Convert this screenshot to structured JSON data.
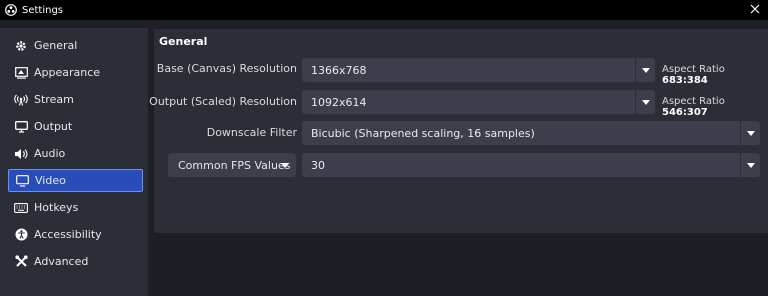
{
  "window": {
    "title": "Settings",
    "app_icon": "obs-logo-icon",
    "close_icon": "close-icon"
  },
  "sidebar": {
    "items": [
      {
        "label": "General",
        "icon": "gear-icon",
        "active": false
      },
      {
        "label": "Appearance",
        "icon": "appearance-icon",
        "active": false
      },
      {
        "label": "Stream",
        "icon": "broadcast-icon",
        "active": false
      },
      {
        "label": "Output",
        "icon": "output-icon",
        "active": false
      },
      {
        "label": "Audio",
        "icon": "speaker-icon",
        "active": false
      },
      {
        "label": "Video",
        "icon": "monitor-icon",
        "active": true
      },
      {
        "label": "Hotkeys",
        "icon": "keyboard-icon",
        "active": false
      },
      {
        "label": "Accessibility",
        "icon": "accessibility-icon",
        "active": false
      },
      {
        "label": "Advanced",
        "icon": "tools-icon",
        "active": false
      }
    ]
  },
  "panel": {
    "title": "General",
    "base_resolution": {
      "label": "Base (Canvas) Resolution",
      "value": "1366x768",
      "aspect_label": "Aspect Ratio",
      "aspect_value": "683:384"
    },
    "output_resolution": {
      "label": "Output (Scaled) Resolution",
      "value": "1092x614",
      "aspect_label": "Aspect Ratio",
      "aspect_value": "546:307"
    },
    "downscale_filter": {
      "label": "Downscale Filter",
      "value": "Bicubic (Sharpened scaling, 16 samples)"
    },
    "fps": {
      "type_label": "Common FPS Values",
      "value": "30"
    }
  },
  "colors": {
    "accent": "#284cb8",
    "panel_bg": "#2b2d37",
    "window_bg": "#1e1f26",
    "combo_bg": "#3c3f4b"
  }
}
